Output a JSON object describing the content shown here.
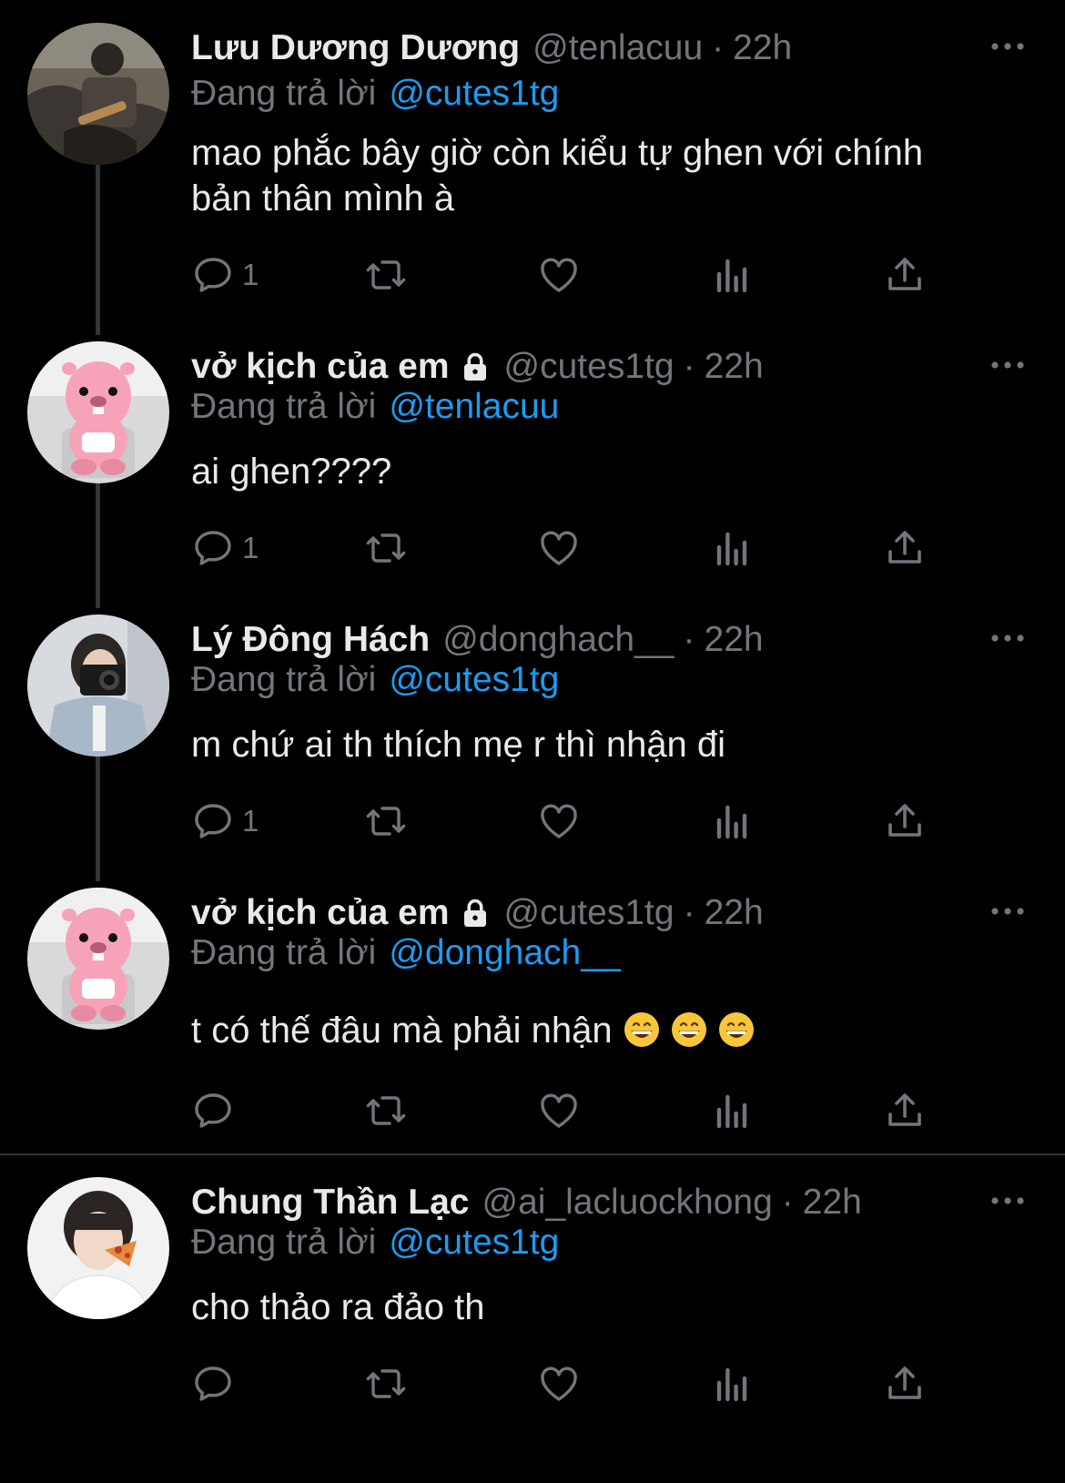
{
  "tweets": [
    {
      "name": "Lưu Dương Dương",
      "handle": "@tenlacuu",
      "time": "22h",
      "reply_label": "Đang trả lời",
      "reply_to": "@cutes1tg",
      "text_lines": [
        "mao phắc bây giờ còn kiểu tự ghen với chính",
        "bản thân mình à"
      ],
      "reply_count": "1"
    },
    {
      "name": "vở kịch của em",
      "handle": "@cutes1tg",
      "time": "22h",
      "reply_label": "Đang trả lời",
      "reply_to": "@tenlacuu",
      "text_lines": [
        "ai ghen????"
      ],
      "reply_count": "1"
    },
    {
      "name": "Lý Đông Hách",
      "handle": "@donghach__",
      "time": "22h",
      "reply_label": "Đang trả lời",
      "reply_to": "@cutes1tg",
      "text_lines": [
        "m chứ ai th thích mẹ r thì nhận đi"
      ],
      "reply_count": "1"
    },
    {
      "name": "vở kịch của em",
      "handle": "@cutes1tg",
      "time": "22h",
      "reply_label": "Đang trả lời",
      "reply_to": "@donghach__",
      "text_lines": [
        "t có thế đâu mà phải nhận"
      ],
      "reply_count": ""
    },
    {
      "name": "Chung Thần Lạc",
      "handle": "@ai_lacluockhong",
      "time": "22h",
      "reply_label": "Đang trả lời",
      "reply_to": "@cutes1tg",
      "text_lines": [
        "cho thảo ra đảo th"
      ],
      "reply_count": ""
    }
  ],
  "icons": {
    "reply": "reply-icon",
    "retweet": "retweet-icon",
    "like": "heart-icon",
    "views": "views-icon",
    "share": "share-icon",
    "more": "more-icon",
    "lock": "lock-icon",
    "emoji": "grinning-emoji"
  },
  "colors": {
    "background": "#000000",
    "text": "#e7e9ea",
    "muted": "#71767b",
    "link": "#1d9bf0",
    "divider": "#2f3336"
  }
}
